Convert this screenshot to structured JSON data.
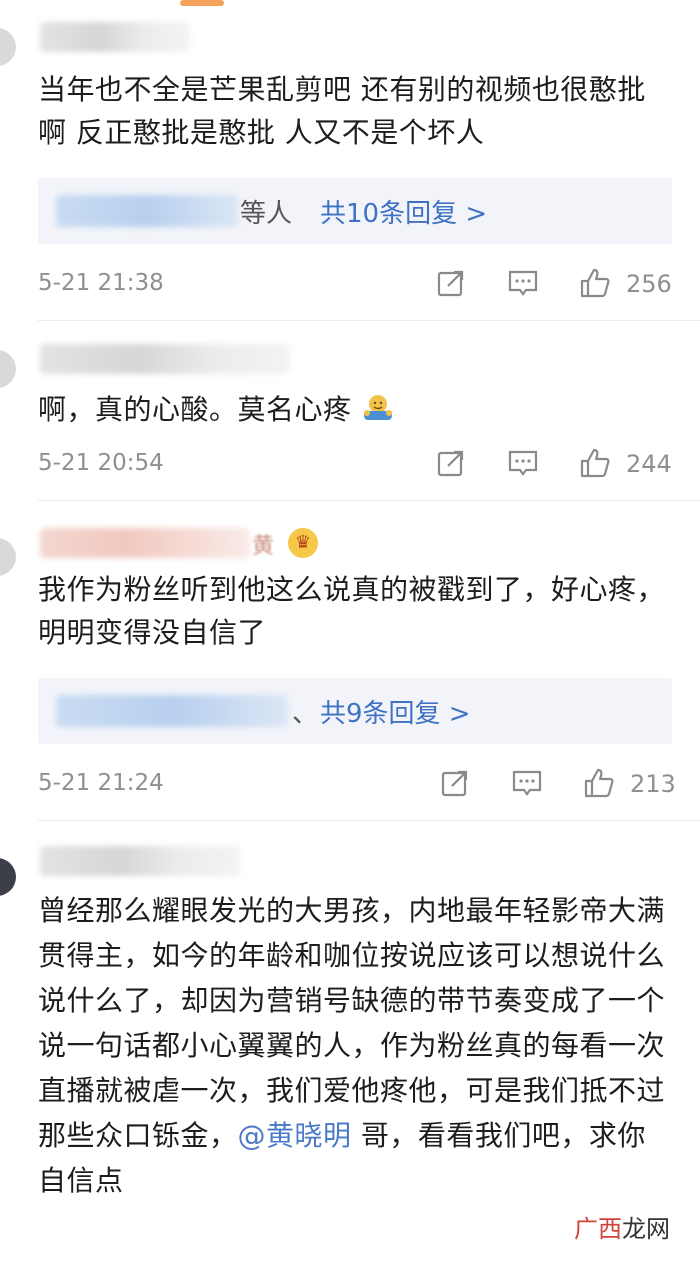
{
  "comments": [
    {
      "text": "当年也不全是芒果乱剪吧 还有别的视频也很憨批啊 反正憨批是憨批 人又不是个坏人",
      "reply_tail": "等人",
      "reply_link": "共10条回复 >",
      "time": "5-21 21:38",
      "likes": "256"
    },
    {
      "text": "啊，真的心酸。莫名心疼",
      "time": "5-21 20:54",
      "likes": "244",
      "emoji_icon": "hug-emoji"
    },
    {
      "name_tail": "黄",
      "badge_icon": "crown-icon",
      "text": "我作为粉丝听到他这么说真的被戳到了，好心疼，明明变得没自信了",
      "reply_tail": "、",
      "reply_link": "共9条回复 >",
      "time": "5-21 21:24",
      "likes": "213"
    },
    {
      "text_before": "曾经那么耀眼发光的大男孩，内地最年轻影帝大满贯得主，如今的年龄和咖位按说应该可以想说什么说什么了，却因为营销号缺德的带节奏变成了一个说一句话都小心翼翼的人，作为粉丝真的每看一次直播就被虐一次，我们爱他疼他，可是我们抵不过那些众口铄金，",
      "mention": "@黄晓明",
      "text_after": " 哥，看看我们吧，求你自信点"
    }
  ],
  "watermark": {
    "part1": "广西",
    "part2": "龙网"
  },
  "colors": {
    "link": "#3f72c4",
    "meta": "#8f8f8f",
    "reply_bg": "#f2f4f9"
  }
}
